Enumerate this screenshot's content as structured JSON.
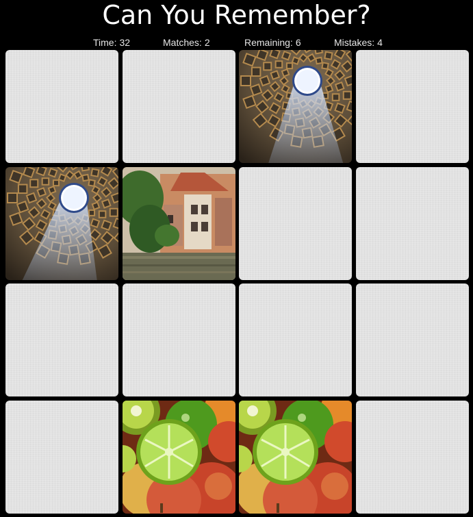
{
  "game": {
    "title": "Can You Remember?",
    "stats": {
      "time_label": "Time:",
      "time_value": "32",
      "matches_label": "Matches:",
      "matches_value": "2",
      "remaining_label": "Remaining:",
      "remaining_value": "6",
      "mistakes_label": "Mistakes:",
      "mistakes_value": "4"
    }
  },
  "board": {
    "rows": 4,
    "cols": 4,
    "cards": [
      {
        "state": "hidden"
      },
      {
        "state": "hidden"
      },
      {
        "state": "revealed",
        "image": "pantheon-oculus"
      },
      {
        "state": "hidden"
      },
      {
        "state": "revealed",
        "image": "pantheon-oculus"
      },
      {
        "state": "revealed",
        "image": "canal-houses"
      },
      {
        "state": "hidden"
      },
      {
        "state": "hidden"
      },
      {
        "state": "hidden"
      },
      {
        "state": "hidden"
      },
      {
        "state": "hidden"
      },
      {
        "state": "hidden"
      },
      {
        "state": "hidden"
      },
      {
        "state": "revealed",
        "image": "fruit-limes-apples"
      },
      {
        "state": "revealed",
        "image": "fruit-limes-apples"
      },
      {
        "state": "hidden"
      }
    ]
  },
  "colors": {
    "background": "#000000",
    "card_back": "#e2e2e2",
    "title_text": "#ffffff",
    "stat_text": "#e6e6e6"
  }
}
